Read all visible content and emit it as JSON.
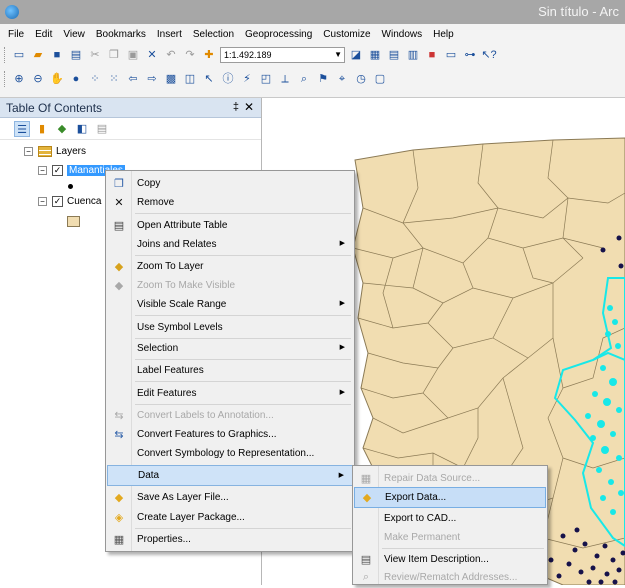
{
  "window": {
    "title": "Sin título - Arc"
  },
  "menubar": [
    "File",
    "Edit",
    "View",
    "Bookmarks",
    "Insert",
    "Selection",
    "Geoprocessing",
    "Customize",
    "Windows",
    "Help"
  ],
  "toolbar": {
    "scale_value": "1:1.492.189"
  },
  "toc": {
    "title": "Table Of Contents",
    "pin_glyph": "‡",
    "close_glyph": "✕",
    "root_label": "Layers",
    "layer1_label": "Manantiales",
    "layer2_label": "Cuenca"
  },
  "context_menu": {
    "items": [
      {
        "label": "Copy",
        "icon": "copy-icon",
        "enabled": true,
        "submenu": false
      },
      {
        "label": "Remove",
        "icon": "remove-icon",
        "enabled": true,
        "submenu": false
      },
      {
        "label": "Open Attribute Table",
        "icon": "table-icon",
        "enabled": true,
        "submenu": false
      },
      {
        "label": "Joins and Relates",
        "icon": "",
        "enabled": true,
        "submenu": true
      },
      {
        "label": "Zoom To Layer",
        "icon": "zoom-layer-icon",
        "enabled": true,
        "submenu": false
      },
      {
        "label": "Zoom To Make Visible",
        "icon": "zoom-visible-icon",
        "enabled": false,
        "submenu": false
      },
      {
        "label": "Visible Scale Range",
        "icon": "",
        "enabled": true,
        "submenu": true
      },
      {
        "label": "Use Symbol Levels",
        "icon": "",
        "enabled": true,
        "submenu": false
      },
      {
        "label": "Selection",
        "icon": "",
        "enabled": true,
        "submenu": true
      },
      {
        "label": "Label Features",
        "icon": "",
        "enabled": true,
        "submenu": false
      },
      {
        "label": "Edit Features",
        "icon": "",
        "enabled": true,
        "submenu": true
      },
      {
        "label": "Convert Labels to Annotation...",
        "icon": "convert-labels-icon",
        "enabled": false,
        "submenu": false
      },
      {
        "label": "Convert Features to Graphics...",
        "icon": "convert-graphics-icon",
        "enabled": true,
        "submenu": false
      },
      {
        "label": "Convert Symbology to Representation...",
        "icon": "",
        "enabled": true,
        "submenu": false
      },
      {
        "label": "Data",
        "icon": "",
        "enabled": true,
        "submenu": true,
        "highlighted": true
      },
      {
        "label": "Save As Layer File...",
        "icon": "layer-file-icon",
        "enabled": true,
        "submenu": false
      },
      {
        "label": "Create Layer Package...",
        "icon": "layer-package-icon",
        "enabled": true,
        "submenu": false
      },
      {
        "label": "Properties...",
        "icon": "properties-icon",
        "enabled": true,
        "submenu": false
      }
    ]
  },
  "data_submenu": {
    "items": [
      {
        "label": "Repair Data Source...",
        "icon": "repair-icon",
        "enabled": false
      },
      {
        "label": "Export Data...",
        "icon": "export-icon",
        "enabled": true,
        "highlighted": true
      },
      {
        "label": "Export to CAD...",
        "icon": "",
        "enabled": true
      },
      {
        "label": "Make Permanent",
        "icon": "",
        "enabled": false
      },
      {
        "label": "View Item Description...",
        "icon": "description-icon",
        "enabled": true
      },
      {
        "label": "Review/Rematch Addresses...",
        "icon": "rematch-icon",
        "enabled": false
      }
    ]
  },
  "colors": {
    "watershed_fill": "#f1ddb1",
    "watershed_stroke": "#8b7a55",
    "highlight_basin": "#18e8e8",
    "points": "#16124a"
  }
}
